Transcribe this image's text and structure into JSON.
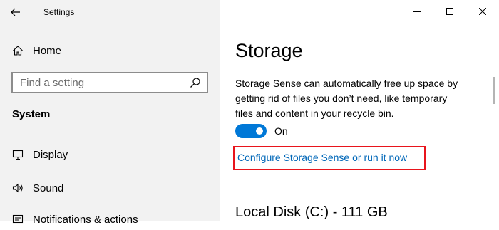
{
  "window": {
    "app_title": "Settings",
    "controls": {
      "minimize": "minimize-icon",
      "maximize": "maximize-icon",
      "close": "close-icon"
    }
  },
  "sidebar": {
    "home": {
      "label": "Home",
      "icon": "home-icon"
    },
    "search": {
      "placeholder": "Find a setting",
      "icon": "search-icon"
    },
    "section": "System",
    "items": [
      {
        "label": "Display",
        "icon": "display-icon"
      },
      {
        "label": "Sound",
        "icon": "sound-icon"
      },
      {
        "label": "Notifications & actions",
        "icon": "notifications-icon"
      }
    ]
  },
  "main": {
    "title": "Storage",
    "description": "Storage Sense can automatically free up space by getting rid of files you don’t need, like temporary files and content in your recycle bin.",
    "toggle": {
      "state": "On",
      "on": true
    },
    "configure_link": "Configure Storage Sense or run it now",
    "disk_heading": "Local Disk (C:) - 111 GB"
  },
  "colors": {
    "accent": "#0078d7",
    "link": "#0067b8",
    "highlight_border": "#e8141c",
    "sidebar_bg": "#f2f2f2"
  }
}
